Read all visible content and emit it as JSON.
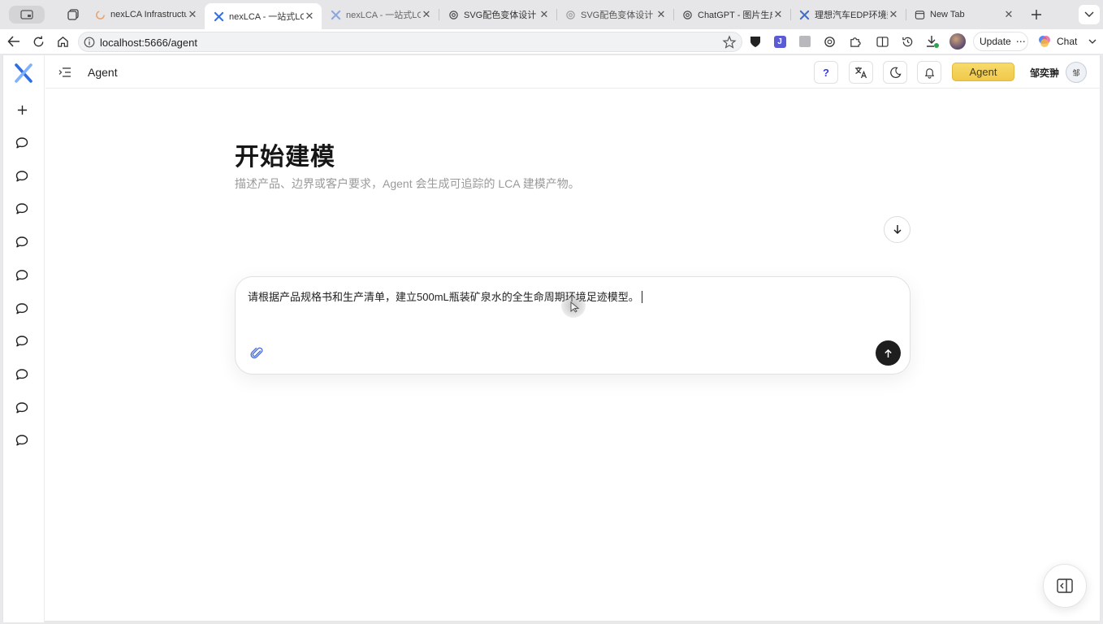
{
  "browser": {
    "tabs": [
      {
        "label": "nexLCA Infrastructu",
        "icon": "spinner-icon"
      },
      {
        "label": "nexLCA - 一站式LCA",
        "icon": "nexlca-logo-icon",
        "active": true
      },
      {
        "label": "nexLCA - 一站式LCA",
        "icon": "nexlca-logo-icon"
      },
      {
        "label": "SVG配色变体设计",
        "icon": "openai-icon"
      },
      {
        "label": "SVG配色变体设计",
        "icon": "openai-icon"
      },
      {
        "label": "ChatGPT - 图片生成",
        "icon": "openai-icon"
      },
      {
        "label": "理想汽车EDP环境数据",
        "icon": "nexlca-logo-icon"
      },
      {
        "label": "New Tab",
        "icon": "new-tab-icon"
      }
    ],
    "url": "localhost:5666/agent",
    "update_label": "Update",
    "chat_label": "Chat"
  },
  "app": {
    "header_title": "Agent",
    "agent_badge": "Agent",
    "user_name": "邹奕翀",
    "user_avatar_text": "邹",
    "help_glyph": "?",
    "sidebar_chat_count": 10
  },
  "main": {
    "title": "开始建模",
    "subtitle": "描述产品、边界或客户要求，Agent 会生成可追踪的 LCA 建模产物。",
    "composer_text": "请根据产品规格书和生产清单，建立500mL瓶装矿泉水的全生命周期环境足迹模型。"
  },
  "colors": {
    "agent_badge_bg": "#f2cd52",
    "send_button_bg": "#1e1e1e",
    "logo_blue": "#2f6fe0"
  }
}
